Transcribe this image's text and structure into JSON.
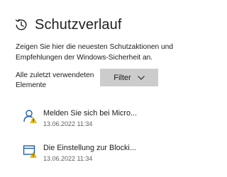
{
  "header": {
    "title": "Schutzverlauf",
    "icon": "history-icon"
  },
  "description": "Zeigen Sie hier die neuesten Schutzaktionen und Empfehlungen der Windows-Sicherheit an.",
  "filter": {
    "label": "Alle zuletzt verwendeten Elemente",
    "button_label": "Filter"
  },
  "items": [
    {
      "title": "Melden Sie sich bei Micro...",
      "date": "13.06.2022 11:34",
      "icon": "account-warning-icon"
    },
    {
      "title": "Die Einstellung zur Blocki...",
      "date": "13.06.2022 11:34",
      "icon": "app-browser-warning-icon"
    }
  ],
  "colors": {
    "button_bg": "#cccccc",
    "icon_blue": "#1f5fa8",
    "warning_yellow": "#f4c20d"
  }
}
